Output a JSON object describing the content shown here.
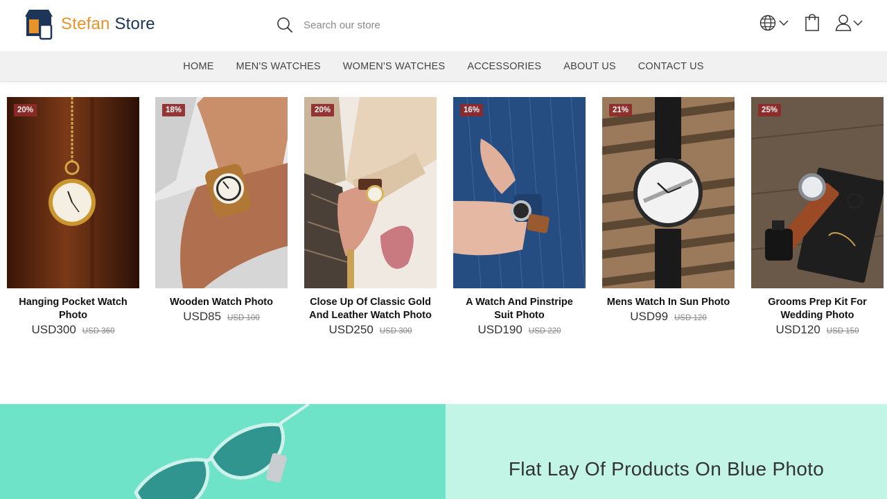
{
  "brand": {
    "name_part1": "Stefan",
    "name_part2": "Store",
    "accent": "#e8932a",
    "navy": "#1d3557"
  },
  "search": {
    "placeholder": "Search our store",
    "icon": "search-icon"
  },
  "header_icons": [
    "globe-icon",
    "bag-icon",
    "user-icon"
  ],
  "nav": {
    "items": [
      "HOME",
      "MEN'S WATCHES",
      "WOMEN'S WATCHES",
      "ACCESSORIES",
      "ABOUT US",
      "CONTACT US"
    ]
  },
  "products": [
    {
      "title": "Hanging Pocket Watch Photo",
      "discount": "20%",
      "price": "USD300",
      "old_price": "USD 360"
    },
    {
      "title": "Wooden Watch Photo",
      "discount": "18%",
      "price": "USD85",
      "old_price": "USD 100"
    },
    {
      "title": "Close Up Of Classic Gold And Leather Watch Photo",
      "discount": "20%",
      "price": "USD250",
      "old_price": "USD 300"
    },
    {
      "title": "A Watch And Pinstripe Suit Photo",
      "discount": "16%",
      "price": "USD190",
      "old_price": "USD 220"
    },
    {
      "title": "Mens Watch In Sun Photo",
      "discount": "21%",
      "price": "USD99",
      "old_price": "USD 120"
    },
    {
      "title": "Grooms Prep Kit For Wedding Photo",
      "discount": "25%",
      "price": "USD120",
      "old_price": "USD 150"
    }
  ],
  "banner": {
    "title": "Flat Lay Of Products On Blue Photo",
    "left_color": "#6fe3c7",
    "right_color": "#c2f5e6"
  }
}
